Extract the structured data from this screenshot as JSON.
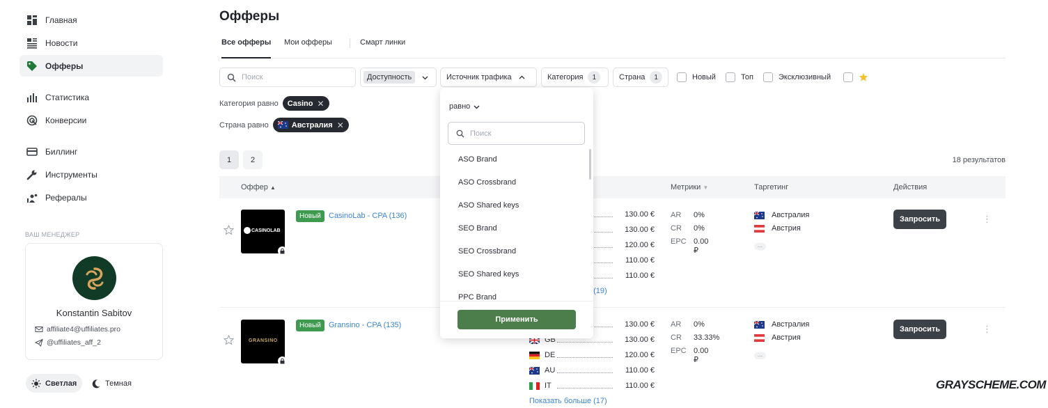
{
  "sidebar": {
    "items": [
      {
        "label": "Главная",
        "icon": "dashboard-icon"
      },
      {
        "label": "Новости",
        "icon": "news-icon"
      },
      {
        "label": "Офферы",
        "icon": "tag-icon"
      },
      {
        "label": "Статистика",
        "icon": "bar-chart-icon"
      },
      {
        "label": "Конверсии",
        "icon": "target-icon"
      },
      {
        "label": "Биллинг",
        "icon": "credit-card-icon"
      },
      {
        "label": "Инструменты",
        "icon": "wrench-icon"
      },
      {
        "label": "Рефералы",
        "icon": "referrals-icon"
      }
    ],
    "active_item": "Офферы",
    "manager": {
      "heading": "ВАШ МЕНЕДЖЕР",
      "name": "Konstantin Sabitov",
      "email": "affiliate4@uffiliates.pro",
      "telegram": "@uffiliates_aff_2"
    },
    "theme": {
      "light": "Светлая",
      "dark": "Темная",
      "active": "Светлая"
    }
  },
  "header": {
    "title": "Офферы",
    "tabs": [
      {
        "label": "Все офферы",
        "active": true
      },
      {
        "label": "Мои офферы",
        "active": false
      },
      {
        "label": "Смарт линки",
        "active": false
      }
    ]
  },
  "filters": {
    "search_placeholder": "Поиск",
    "availability": "Доступность",
    "traffic_source": "Источник трафика",
    "category": {
      "label": "Категория",
      "count": "1"
    },
    "country": {
      "label": "Страна",
      "count": "1"
    },
    "checkboxes": [
      "Новый",
      "Топ",
      "Эксклюзивный"
    ],
    "favorites_icon": "star-icon"
  },
  "active_conditions": [
    {
      "label": "Категория равно",
      "chip": "Casino"
    },
    {
      "label": "Страна равно",
      "chip": "Австралия"
    }
  ],
  "pagination": {
    "pages": [
      "1",
      "2"
    ],
    "current": "1"
  },
  "results_text": "18 результатов",
  "table": {
    "headers": {
      "offer": "Оффер",
      "metrics": "Метрики",
      "targeting": "Таргетинг",
      "actions": "Действия"
    },
    "rows": [
      {
        "badge": "Новый",
        "name": "CasinoLab - CPA (136)",
        "thumb_text": "CASINOLAB",
        "payouts": [
          "130.00 €",
          "130.00 €",
          "120.00 €",
          "110.00 €",
          "110.00 €"
        ],
        "more": "Показать больше (19)",
        "metrics": [
          {
            "k": "AR",
            "v": "0%"
          },
          {
            "k": "CR",
            "v": "0%"
          },
          {
            "k": "EPC",
            "v": "0.00 ₽"
          }
        ],
        "geo": [
          "Австралия",
          "Австрия"
        ],
        "geo_more": "...",
        "action": "Запросить"
      },
      {
        "badge": "Новый",
        "name": "Gransino - CPA (135)",
        "thumb_text": "GRANSINO",
        "payouts": [
          "130.00 €",
          "130.00 €",
          "120.00 €",
          "110.00 €",
          "110.00 €"
        ],
        "payout_codes": [
          "",
          "GB",
          "DE",
          "AU",
          "IT"
        ],
        "more": "Показать больше (17)",
        "metrics": [
          {
            "k": "AR",
            "v": "0%"
          },
          {
            "k": "CR",
            "v": "33.33%"
          },
          {
            "k": "EPC",
            "v": "0.00 ₽"
          }
        ],
        "geo": [
          "Австралия",
          "Австрия"
        ],
        "geo_more": "...",
        "action": "Запросить"
      }
    ]
  },
  "dropdown": {
    "operator": "равно",
    "search_placeholder": "Поиск",
    "items": [
      "ASO Brand",
      "ASO Crossbrand",
      "ASO Shared keys",
      "SEO Brand",
      "SEO Crossbrand",
      "SEO Shared keys",
      "PPC Brand"
    ],
    "apply": "Применить"
  },
  "watermark": "GRAYSCHEME.COM",
  "colors": {
    "accent_green": "#3d9a4f",
    "apply_green": "#4c7e4b",
    "link_blue": "#3b86d6",
    "dark_button": "#3c4047"
  }
}
